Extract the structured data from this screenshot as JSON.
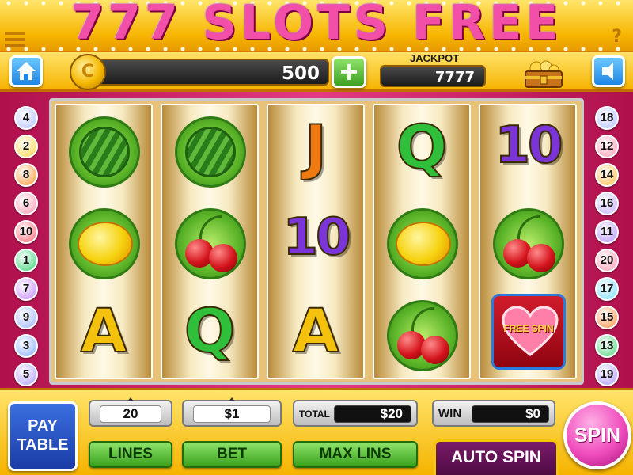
{
  "title": "777 SLOTS FREE",
  "status": {
    "coin_symbol": "C",
    "coins": "500",
    "add_label": "+",
    "jackpot_label": "JACKPOT",
    "jackpot_value": "7777"
  },
  "left_lines": [
    {
      "num": "4",
      "color": "#c9d2ff"
    },
    {
      "num": "2",
      "color": "#ffe07a"
    },
    {
      "num": "8",
      "color": "#ffb36b"
    },
    {
      "num": "6",
      "color": "#ffb6c8"
    },
    {
      "num": "10",
      "color": "#ff8f9a"
    },
    {
      "num": "1",
      "color": "#6fe09a"
    },
    {
      "num": "7",
      "color": "#d5a8ff"
    },
    {
      "num": "9",
      "color": "#b9c8ff"
    },
    {
      "num": "3",
      "color": "#a8c4ff"
    },
    {
      "num": "5",
      "color": "#c6b8ff"
    }
  ],
  "right_lines": [
    {
      "num": "18",
      "color": "#c9d2ff"
    },
    {
      "num": "12",
      "color": "#ffb6c8"
    },
    {
      "num": "14",
      "color": "#ffd07a"
    },
    {
      "num": "16",
      "color": "#d5c8ff"
    },
    {
      "num": "11",
      "color": "#c8b0ff"
    },
    {
      "num": "20",
      "color": "#ffb6c8"
    },
    {
      "num": "17",
      "color": "#9fe6ff"
    },
    {
      "num": "15",
      "color": "#ffb07a"
    },
    {
      "num": "13",
      "color": "#7fe0a0"
    },
    {
      "num": "19",
      "color": "#c6b8ff"
    }
  ],
  "reels": [
    [
      "watermelon",
      "lemon",
      "A"
    ],
    [
      "watermelon",
      "cherry",
      "Q"
    ],
    [
      "J",
      "10",
      "A"
    ],
    [
      "Q",
      "lemon",
      "cherry"
    ],
    [
      "10",
      "cherry",
      "free-spin"
    ]
  ],
  "symbol_text": {
    "A": "A",
    "Q": "Q",
    "J": "J",
    "10": "10",
    "free_spin": "FREE SPIN"
  },
  "symbol_colors": {
    "A": "#f4c20d",
    "Q": "#2fbf3a",
    "J": "#f07a12",
    "10": "#7a34d8"
  },
  "controls": {
    "pay_table_line1": "PAY",
    "pay_table_line2": "TABLE",
    "lines_value": "20",
    "bet_value": "$1",
    "total_label": "TOTAL",
    "total_value": "$20",
    "win_label": "WIN",
    "win_value": "$0",
    "lines_button": "LINES",
    "bet_button": "BET",
    "max_lines_button": "MAX LINS",
    "auto_spin_button": "AUTO SPIN",
    "spin_button": "SPIN"
  }
}
